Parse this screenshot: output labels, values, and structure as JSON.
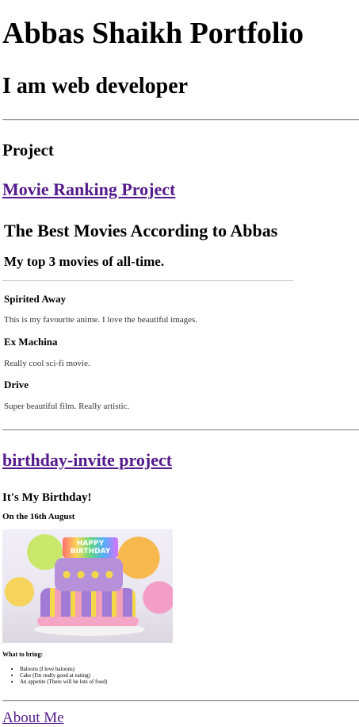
{
  "header": {
    "title": "Abbas Shaikh Portfolio",
    "subtitle": "I am web developer"
  },
  "projects": {
    "heading": "Project",
    "movie": {
      "link_label": "Movie Ranking Project",
      "preview": {
        "title": "The Best Movies According to Abbas",
        "subtitle": "My top 3 movies of all-time.",
        "items": [
          {
            "name": "Spirited Away",
            "desc": "This is my favourite anime. I love the beautiful images."
          },
          {
            "name": "Ex Machina",
            "desc": "Really cool sci-fi movie."
          },
          {
            "name": "Drive",
            "desc": "Super beautiful film. Really artistic."
          }
        ]
      }
    },
    "birthday": {
      "link_label": "birthday-invite project",
      "preview": {
        "title": "It's My Birthday!",
        "date": "On the 16th August",
        "cake_sign": "HAPPY BIRTHDAY",
        "bring_heading": "What to bring:",
        "bring_items": [
          "Baloons (I love baloons)",
          "Cake (I'm really good at eating)",
          "An appetite (There will be lots of food)"
        ]
      }
    }
  },
  "footer": {
    "about_label": "About Me"
  }
}
